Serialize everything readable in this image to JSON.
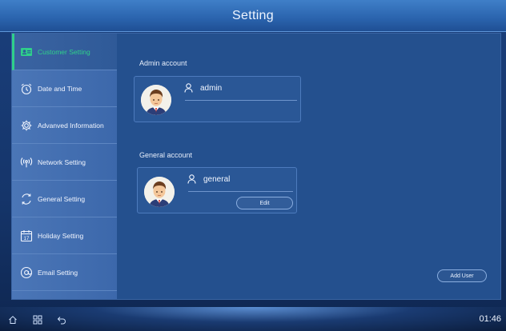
{
  "header": {
    "title": "Setting"
  },
  "sidebar": {
    "items": [
      {
        "label": "Customer Setting",
        "icon": "id-card-icon",
        "active": true
      },
      {
        "label": "Date and Time",
        "icon": "alarm-clock-icon",
        "active": false
      },
      {
        "label": "Advanved Information",
        "icon": "gear-icon",
        "active": false
      },
      {
        "label": "Network Setting",
        "icon": "wifi-signal-icon",
        "active": false
      },
      {
        "label": "General Setting",
        "icon": "refresh-icon",
        "active": false
      },
      {
        "label": "Holiday Setting",
        "icon": "calendar-icon",
        "active": false
      },
      {
        "label": "Email Setting",
        "icon": "at-sign-icon",
        "active": false
      }
    ]
  },
  "main": {
    "admin": {
      "section_label": "Admin account",
      "username": "admin"
    },
    "general": {
      "section_label": "General account",
      "username": "general",
      "edit_label": "Edit"
    },
    "add_user_label": "Add User"
  },
  "status_bar": {
    "time": "01:46",
    "icons": [
      "home-icon",
      "apps-grid-icon",
      "back-icon"
    ]
  },
  "colors": {
    "accent": "#2fd08a",
    "sidebar": "#4470b2",
    "content": "#24508e",
    "title_bar": "#2a63ad"
  }
}
